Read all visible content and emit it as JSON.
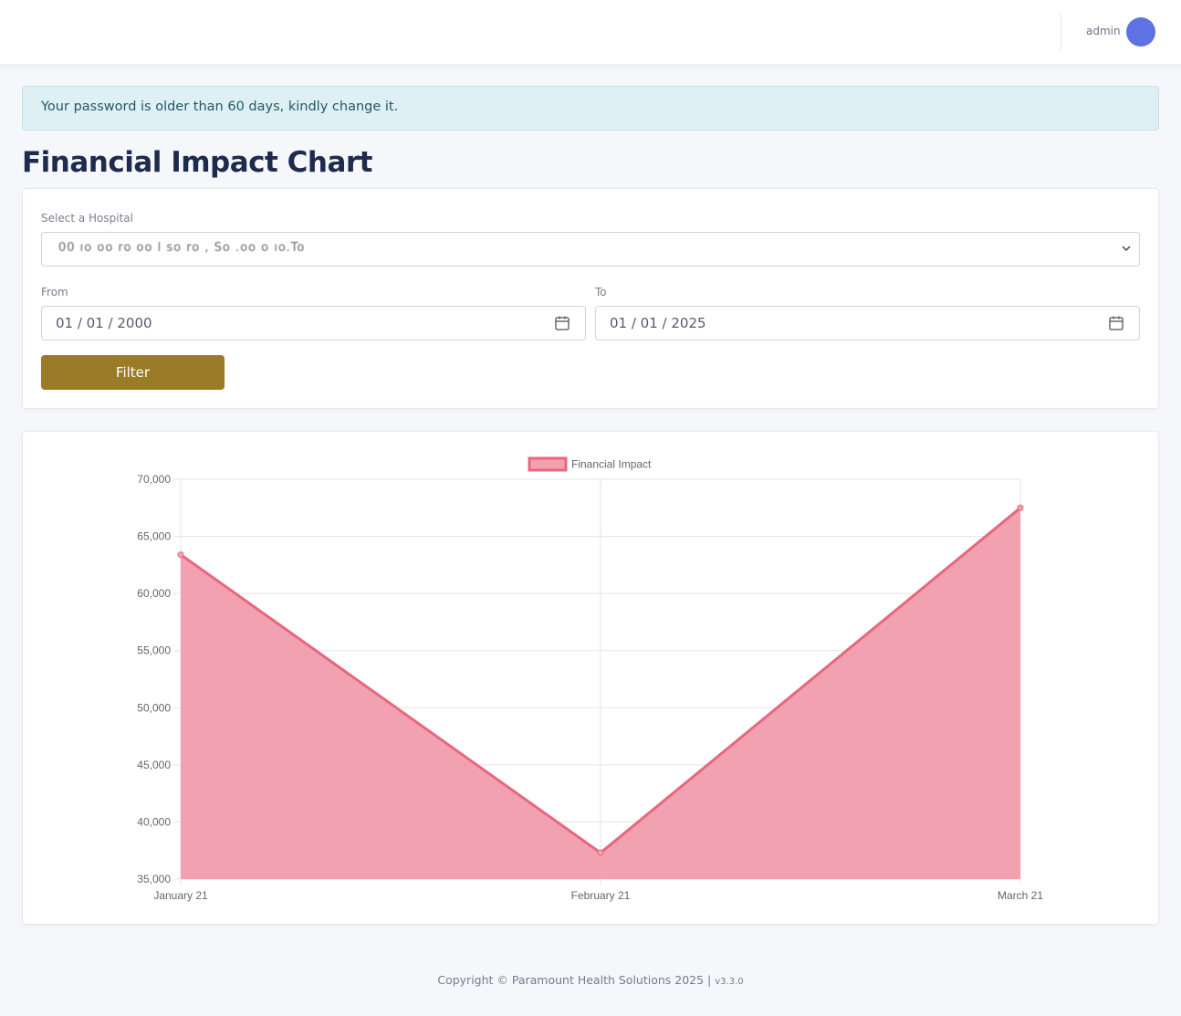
{
  "topbar": {
    "user_name": "admin"
  },
  "alert": {
    "text": "Your password is older than 60 days, kindly change it."
  },
  "page": {
    "title": "Financial Impact Chart"
  },
  "filters": {
    "hospital_label": "Select a Hospital",
    "hospital_value": "00 ıo oo ro oo l so ro , So .oo o ıo.To",
    "from_label": "From",
    "from_value": "01 / 01 / 2000",
    "to_label": "To",
    "to_value": "01 / 01 / 2025",
    "filter_button": "Filter"
  },
  "chart_data": {
    "type": "area",
    "categories": [
      "January 21",
      "February 21",
      "March 21"
    ],
    "series": [
      {
        "name": "Financial Impact",
        "values": [
          63400,
          37300,
          67500
        ]
      }
    ],
    "ylim": [
      35000,
      70000
    ],
    "yticks": [
      70000,
      65000,
      60000,
      55000,
      50000,
      45000,
      40000,
      35000
    ],
    "ytick_labels": [
      "70,000",
      "65,000",
      "60,000",
      "55,000",
      "50,000",
      "45,000",
      "40,000",
      "35,000"
    ],
    "grid": true,
    "legend_position": "top",
    "colors": {
      "fill": "#f2a1b0",
      "line": "#e8677f"
    }
  },
  "footer": {
    "copyright": "Copyright © Paramount Health Solutions 2025 |",
    "version": "v3.3.0"
  }
}
